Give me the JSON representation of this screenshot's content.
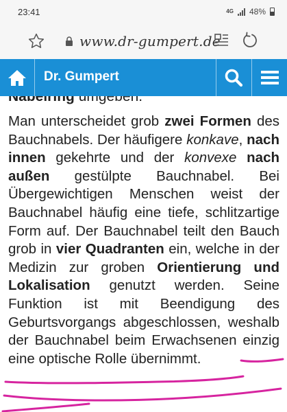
{
  "status_bar": {
    "time": "23:41",
    "network": "4G",
    "battery": "48%"
  },
  "browser": {
    "url": "www.dr-gumpert.de"
  },
  "header": {
    "title": "Dr. Gumpert"
  },
  "article": {
    "partial_heading_bold": "Nabelring",
    "partial_heading_rest": " umgeben.",
    "segments": [
      {
        "t": "Man unterscheidet grob ",
        "s": "n"
      },
      {
        "t": "zwei Formen",
        "s": "b"
      },
      {
        "t": " des Bauchnabels. Der häufigere ",
        "s": "n"
      },
      {
        "t": "konkave",
        "s": "i"
      },
      {
        "t": ", ",
        "s": "n"
      },
      {
        "t": "nach innen",
        "s": "b"
      },
      {
        "t": " gekehrte und der ",
        "s": "n"
      },
      {
        "t": "konvexe",
        "s": "i"
      },
      {
        "t": " ",
        "s": "n"
      },
      {
        "t": "nach außen",
        "s": "b"
      },
      {
        "t": " gestülpte Bauchnabel. Bei Übergewichtigen Menschen weist der Bauchnabel häufig eine tiefe, schlitzartige Form auf. Der Bauchnabel teilt den Bauch grob in ",
        "s": "n"
      },
      {
        "t": "vier Quadranten",
        "s": "b"
      },
      {
        "t": " ein, welche in der Medizin zur groben ",
        "s": "n"
      },
      {
        "t": "Orientierung und Lokalisation",
        "s": "b"
      },
      {
        "t": " genutzt werden. Seine Funktion ist mit Beendigung des Geburtsvorgangs abgeschlossen, weshalb der Bauchnabel beim Erwachsenen einzig eine optische Rolle übernimmt.",
        "s": "n"
      }
    ]
  },
  "colors": {
    "header_bg": "#1a8fd6",
    "annotation": "#d6249f"
  }
}
